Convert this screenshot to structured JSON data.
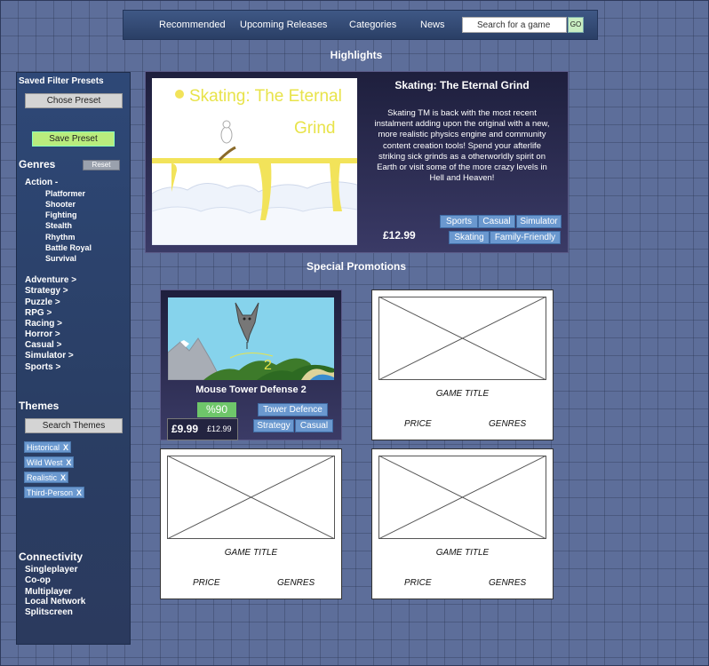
{
  "nav": {
    "items": [
      "Recommended",
      "Upcoming Releases",
      "Categories",
      "News"
    ],
    "search_placeholder": "Search for a game",
    "go_label": "GO"
  },
  "highlights_heading": "Highlights",
  "special_heading": "Special Promotions",
  "sidebar": {
    "presets_title": "Saved Filter Presets",
    "chose_preset": "Chose Preset",
    "save_preset": "Save Preset",
    "genres_title": "Genres",
    "reset_label": "Reset",
    "action_label": "Action -",
    "action_subgenres": [
      "Platformer",
      "Shooter",
      "Fighting",
      "Stealth",
      "Rhythm",
      "Battle Royal",
      "Survival"
    ],
    "genres": [
      "Adventure >",
      "Strategy >",
      "Puzzle >",
      "RPG >",
      "Racing >",
      "Horror >",
      "Casual >",
      "Simulator >",
      "Sports >"
    ],
    "themes_title": "Themes",
    "search_themes": "Search Themes",
    "theme_tags": [
      "Historical",
      "Wild West",
      "Realistic",
      "Third-Person"
    ],
    "remove_label": "X",
    "connectivity_title": "Connectivity",
    "connectivity": [
      "Singleplayer",
      "Co-op",
      "Multiplayer",
      "Local Network",
      "Splitscreen"
    ]
  },
  "highlight": {
    "art_title_line1": "Skating: The Eternal",
    "art_title_line2": "Grind",
    "title": "Skating: The Eternal Grind",
    "description": "Skating TM is back with the most recent instalment adding upon the original with a new, more realistic physics engine and community content creation tools! Spend your afterlife striking sick grinds as a otherworldly spirit on Earth or visit some of the more crazy levels in Hell and Heaven!",
    "price": "£12.99",
    "tags": [
      "Sports",
      "Casual",
      "Simulator",
      "Skating",
      "Family-Friendly"
    ]
  },
  "promo1": {
    "art_number": "2",
    "title": "Mouse Tower Defense 2",
    "discount": "%90",
    "price": "£9.99",
    "old_price": "£12.99",
    "tags": [
      "Tower Defence",
      "Strategy",
      "Casual"
    ]
  },
  "placeholder_card": {
    "title": "GAME TITLE",
    "price": "PRICE",
    "genres": "GENRES"
  },
  "colors": {
    "background": "#5d6e9a",
    "panel_dark": "#1e1f3d",
    "tag_blue": "#6a98cf",
    "save_green": "#b9ec7d",
    "discount_green": "#6ec66a",
    "highlight_text_yellow": "#e8e34a"
  }
}
